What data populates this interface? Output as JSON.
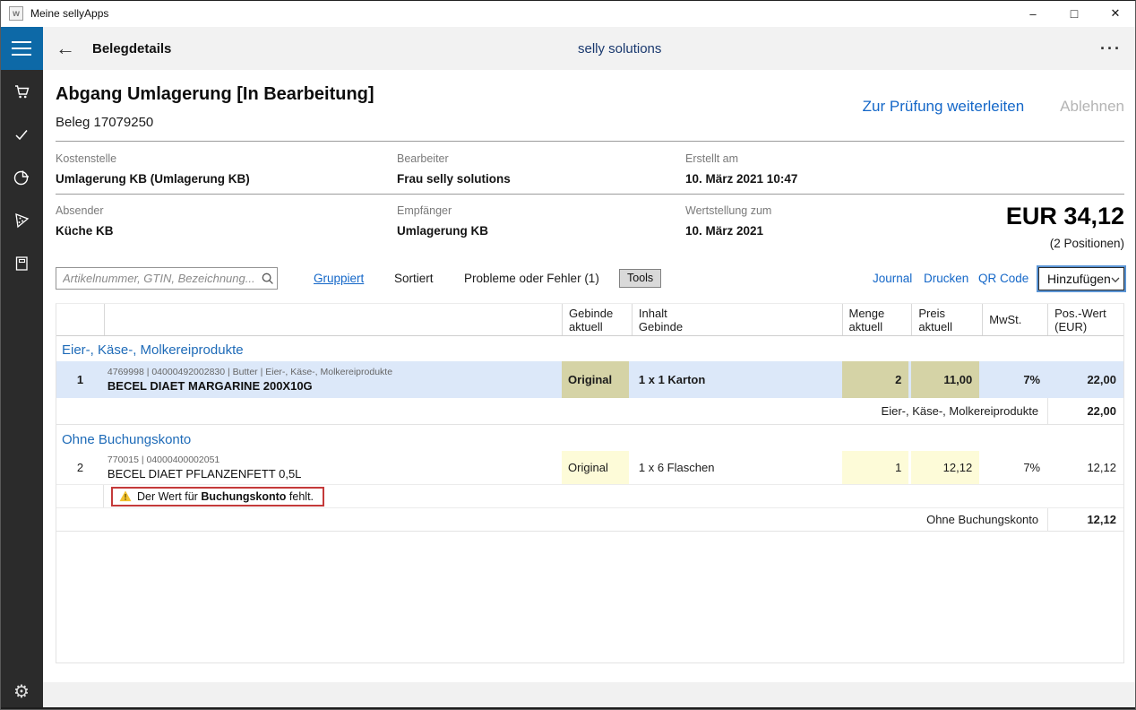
{
  "window": {
    "title": "Meine sellyApps",
    "minimize": "–",
    "maximize": "□",
    "close": "✕"
  },
  "appbar": {
    "back": "←",
    "title": "Belegdetails",
    "center": "selly solutions",
    "more": "···"
  },
  "sidebar": {
    "icons": [
      "cart",
      "check",
      "pie-chart",
      "pizza-slice",
      "book",
      "gear"
    ],
    "gear_glyph": "⚙"
  },
  "doc": {
    "title": "Abgang Umlagerung [In Bearbeitung]",
    "subtitle": "Beleg 17079250",
    "action_forward": "Zur Prüfung weiterleiten",
    "action_reject": "Ablehnen"
  },
  "info": {
    "f1": {
      "label": "Kostenstelle",
      "value": "Umlagerung KB (Umlagerung KB)"
    },
    "f2": {
      "label": "Bearbeiter",
      "value": "Frau selly solutions"
    },
    "f3": {
      "label": "Erstellt am",
      "value": "10. März 2021 10:47"
    },
    "f4": {
      "label": "Absender",
      "value": "Küche KB"
    },
    "f5": {
      "label": "Empfänger",
      "value": "Umlagerung KB"
    },
    "f6": {
      "label": "Wertstellung zum",
      "value": "10. März 2021"
    },
    "total": "EUR 34,12",
    "positions": "(2 Positionen)"
  },
  "toolbar": {
    "search_placeholder": "Artikelnummer, GTIN, Bezeichnung...",
    "gruppiert": "Gruppiert",
    "sortiert": "Sortiert",
    "probleme": "Probleme oder Fehler (1)",
    "tools": "Tools",
    "journal": "Journal",
    "drucken": "Drucken",
    "qr": "QR Code",
    "hinzufuegen": "Hinzufügen"
  },
  "table": {
    "headers": {
      "gebinde": {
        "l1": "Gebinde",
        "l2": "aktuell"
      },
      "inhalt": {
        "l1": "Inhalt",
        "l2": "Gebinde"
      },
      "menge": {
        "l1": "Menge",
        "l2": "aktuell"
      },
      "preis": {
        "l1": "Preis",
        "l2": "aktuell"
      },
      "mwst": {
        "l1": "MwSt."
      },
      "wert": {
        "l1": "Pos.-Wert",
        "l2": "(EUR)"
      }
    },
    "groups": [
      {
        "name": "Eier-, Käse-, Molkereiprodukte",
        "row": {
          "num": "1",
          "meta": "4769998 | 04000492002830 | Butter | Eier-, Käse-, Molkereiprodukte",
          "title": "BECEL DIAET MARGARINE 200X10G",
          "gebinde": "Original",
          "inhalt": "1 x 1 Karton",
          "menge": "2",
          "preis": "11,00",
          "mwst": "7%",
          "wert": "22,00"
        },
        "subtotal_label": "Eier-, Käse-, Molkereiprodukte",
        "subtotal_value": "22,00"
      },
      {
        "name": "Ohne Buchungskonto",
        "row": {
          "num": "2",
          "meta": "770015 | 04000400002051",
          "title": "BECEL DIAET PFLANZENFETT 0,5L",
          "gebinde": "Original",
          "inhalt": "1 x 6 Flaschen",
          "menge": "1",
          "preis": "12,12",
          "mwst": "7%",
          "wert": "12,12"
        },
        "warning": {
          "prefix": "Der Wert für ",
          "bold": "Buchungskonto",
          "suffix": " fehlt."
        },
        "subtotal_label": "Ohne Buchungskonto",
        "subtotal_value": "12,12"
      }
    ]
  },
  "colors": {
    "accent_blue": "#0d69a7",
    "link_blue": "#1467c8",
    "brand_navy": "#19386e",
    "group_blue": "#1e6bb8",
    "row_highlight": "#dce8f9",
    "cell_khaki": "#d5d3a6",
    "cell_paleyellow": "#fdfbd8",
    "warning_red": "#c43a3a",
    "warning_yellow": "#f2c230",
    "sidebar_dark": "#2b2b2b"
  }
}
